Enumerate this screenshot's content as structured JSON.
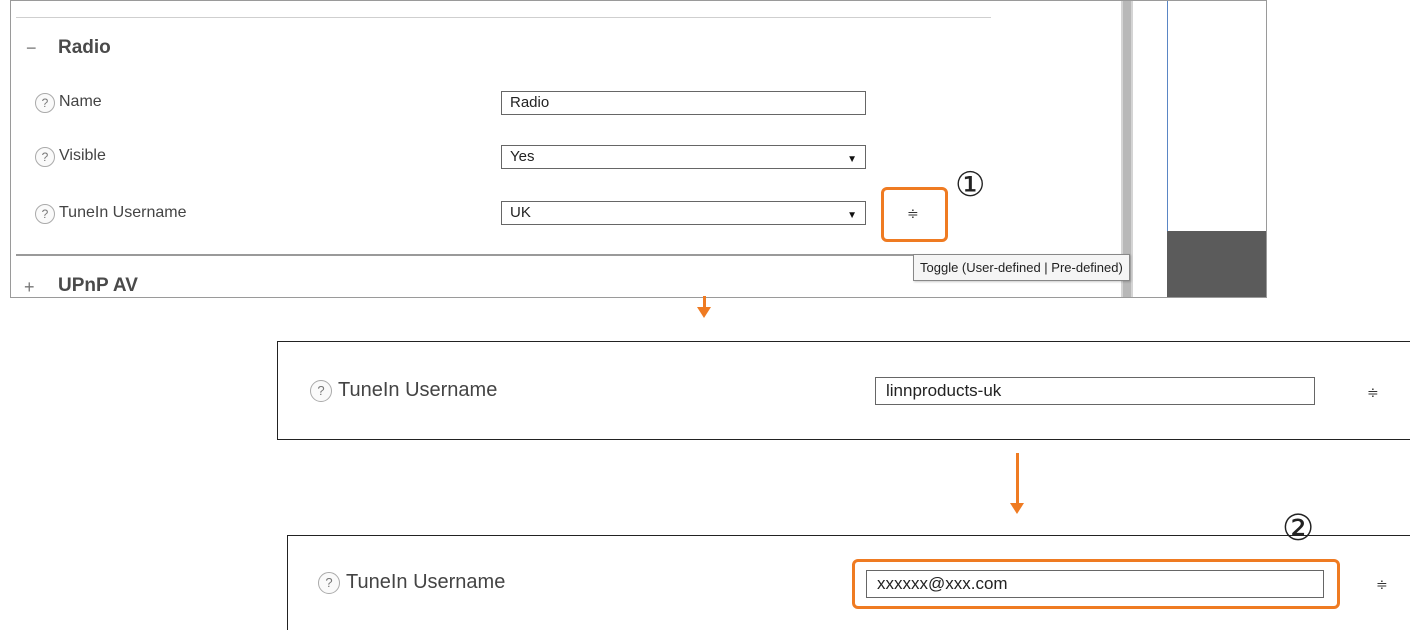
{
  "panel1": {
    "section_radio": {
      "toggle": "−",
      "title": "Radio"
    },
    "rows": [
      {
        "help": "?",
        "label": "Name",
        "value": "Radio",
        "type": "text"
      },
      {
        "help": "?",
        "label": "Visible",
        "value": "Yes",
        "type": "select"
      },
      {
        "help": "?",
        "label": "TuneIn Username",
        "value": "UK",
        "type": "select"
      }
    ],
    "stepper_glyph": "≑",
    "marker": "①",
    "tooltip": "Toggle (User-defined | Pre-defined)",
    "section_upnp": {
      "toggle": "+",
      "title": "UPnP AV"
    }
  },
  "panel2": {
    "help": "?",
    "label": "TuneIn Username",
    "value": "linnproducts-uk",
    "stepper_glyph": "≑"
  },
  "panel3": {
    "help": "?",
    "label": "TuneIn Username",
    "value": "xxxxxx@xxx.com",
    "stepper_glyph": "≑",
    "marker": "②"
  },
  "colors": {
    "highlight": "#ef7b22",
    "panel_border": "#222222"
  },
  "icons": [
    "help-icon",
    "dropdown-arrow-icon",
    "stepper-toggle-icon",
    "scroll-icon"
  ]
}
